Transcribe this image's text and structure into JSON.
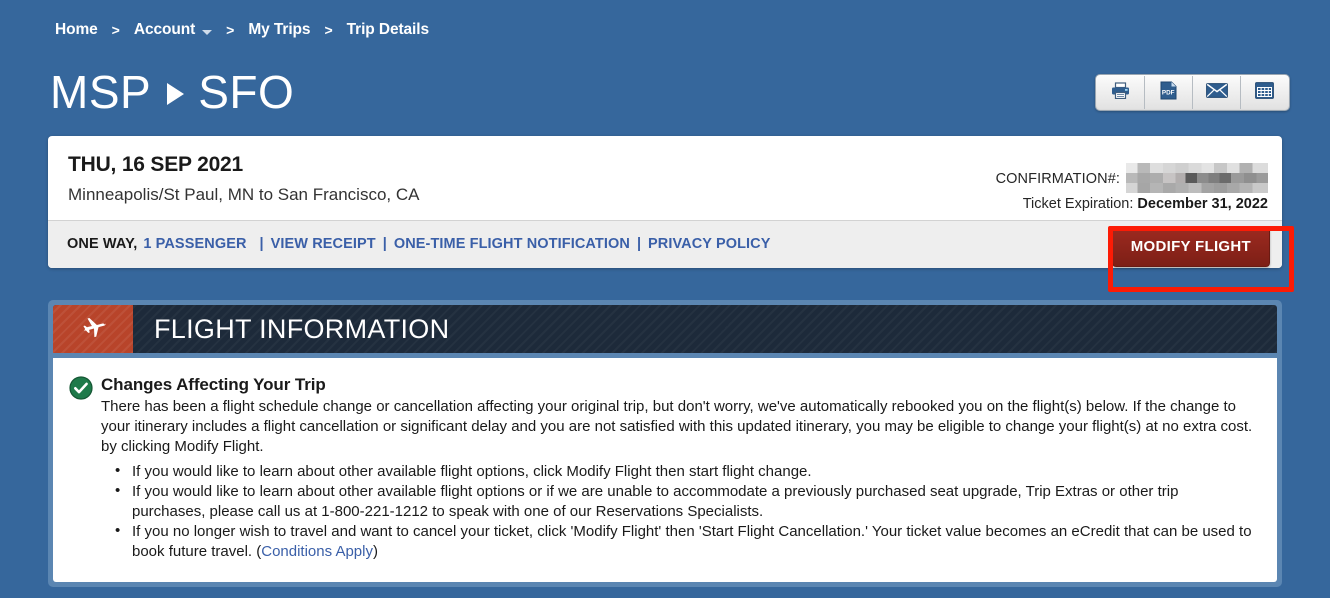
{
  "breadcrumb": {
    "items": [
      {
        "label": "Home",
        "has_caret": false
      },
      {
        "label": "Account",
        "has_caret": true
      },
      {
        "label": "My Trips",
        "has_caret": false
      },
      {
        "label": "Trip Details",
        "has_caret": false
      }
    ],
    "separator": ">"
  },
  "header": {
    "origin_code": "MSP",
    "destination_code": "SFO",
    "actions": [
      {
        "name": "print-icon",
        "label": "Print"
      },
      {
        "name": "pdf-icon",
        "label": "PDF"
      },
      {
        "name": "email-icon",
        "label": "Email"
      },
      {
        "name": "calendar-icon",
        "label": "Calendar"
      }
    ]
  },
  "trip": {
    "date": "THU, 16 SEP 2021",
    "route": "Minneapolis/St Paul, MN to San Francisco, CA",
    "confirmation_label": "CONFIRMATION#:",
    "confirmation_value": "",
    "ticket_expiration_label": "Ticket Expiration:",
    "ticket_expiration_value": "December 31, 2022"
  },
  "links_strip": {
    "trip_type": "ONE WAY,",
    "passengers": "1 PASSENGER",
    "links": [
      "VIEW RECEIPT",
      "ONE-TIME FLIGHT NOTIFICATION",
      "PRIVACY POLICY"
    ],
    "pipe": "|",
    "modify_flight": "MODIFY FLIGHT"
  },
  "flight_information": {
    "section_title": "FLIGHT INFORMATION",
    "notice": {
      "title": "Changes Affecting Your Trip",
      "paragraph": "There has been a flight schedule change or cancellation affecting your original trip, but don't worry, we've automatically rebooked you on the flight(s) below. If the change to your itinerary includes a flight cancellation or significant delay and you are not satisfied with this updated itinerary, you may be eligible to change your flight(s) at no extra cost. by clicking Modify Flight.",
      "bullets": [
        "If you would like to learn about other available flight options, click Modify Flight then start flight change.",
        "If you would like to learn about other available flight options or if we are unable to accommodate a previously purchased seat upgrade, Trip Extras or other trip purchases, please call us at 1-800-221-1212 to speak with one of our Reservations Specialists.",
        "If you no longer wish to travel and want to cancel your ticket, click 'Modify Flight' then 'Start Flight Cancellation.' Your ticket value becomes an eCredit that can be used to book future travel. ("
      ],
      "conditions_link": "Conditions Apply",
      "bullet_tail": ")"
    }
  },
  "colors": {
    "page_background": "#36679c",
    "link_blue": "#3a5fa8",
    "modify_button": "#8d2419",
    "highlight_box": "#fc1b05",
    "panel_header": "#1d2a3a",
    "plane_badge": "#b8442a",
    "check_green": "#1e7a4a"
  }
}
